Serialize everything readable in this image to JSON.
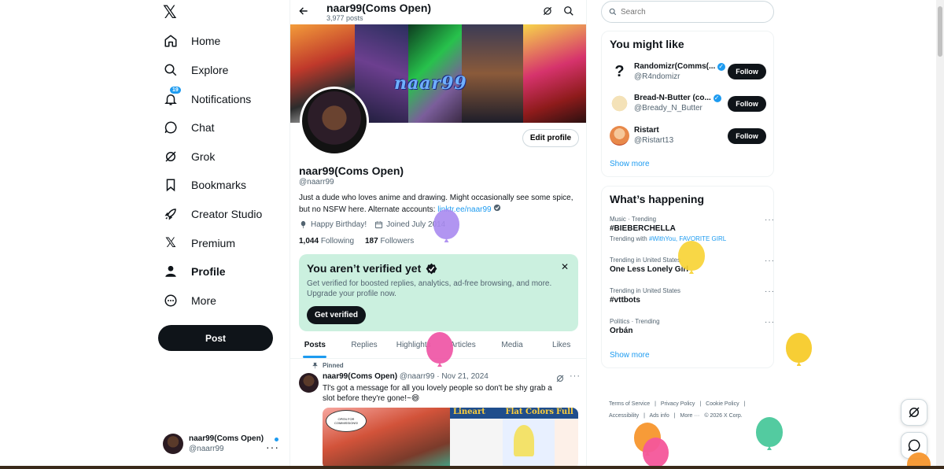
{
  "nav": {
    "logo": "𝕏",
    "items": [
      {
        "label": "Home",
        "icon": "home-icon"
      },
      {
        "label": "Explore",
        "icon": "search-icon"
      },
      {
        "label": "Notifications",
        "icon": "bell-icon",
        "badge": "19"
      },
      {
        "label": "Chat",
        "icon": "chat-icon"
      },
      {
        "label": "Grok",
        "icon": "grok-icon"
      },
      {
        "label": "Bookmarks",
        "icon": "bookmark-icon"
      },
      {
        "label": "Creator Studio",
        "icon": "rocket-icon"
      },
      {
        "label": "Premium",
        "icon": "x-logo-icon"
      },
      {
        "label": "Profile",
        "icon": "person-icon"
      },
      {
        "label": "More",
        "icon": "more-circle-icon"
      }
    ],
    "post_label": "Post",
    "account": {
      "display_name": "naar99(Coms Open)",
      "handle": "@naarr99"
    }
  },
  "header": {
    "title": "naar99(Coms Open)",
    "post_count": "3,977 posts"
  },
  "banner": {
    "text": "naar99"
  },
  "profile": {
    "edit_label": "Edit profile",
    "name": "naar99(Coms Open)",
    "handle": "@naarr99",
    "bio": "Just a dude who loves anime and drawing. Might occasionally see some spice, but no NSFW here. Alternate accounts: ",
    "bio_link": "linktr.ee/naar99",
    "birthday": "Happy Birthday!",
    "joined": "Joined July 2014",
    "following_count": "1,044",
    "following_label": "Following",
    "followers_count": "187",
    "followers_label": "Followers"
  },
  "verify": {
    "title": "You aren’t verified yet",
    "description": "Get verified for boosted replies, analytics, ad-free browsing, and more. Upgrade your profile now.",
    "button": "Get verified",
    "close": "✕"
  },
  "tabs": [
    "Posts",
    "Replies",
    "Highlights",
    "Articles",
    "Media",
    "Likes"
  ],
  "tweet": {
    "pinned": "Pinned",
    "name": "naar99(Coms Open)",
    "handle": "@naarr99",
    "date": "· Nov 21, 2024",
    "text": "Tl's got a message for all you lovely people so don't be shy grab a slot before they're gone!~😄",
    "media_labels": [
      "Lineart",
      "Flat Colors",
      "Full"
    ],
    "speech": "OPEN FOR COMMISSIONS!"
  },
  "search": {
    "placeholder": "Search"
  },
  "might_like": {
    "title": "You might like",
    "users": [
      {
        "name": "Randomizr(Comms(...",
        "handle": "@R4ndomizr",
        "follow": "Follow",
        "avatar_color": "#ffffff"
      },
      {
        "name": "Bread-N-Butter (co...",
        "handle": "@Bready_N_Butter",
        "follow": "Follow",
        "avatar_color": "#f4e2b8"
      },
      {
        "name": "Ristart",
        "handle": "@Ristart13",
        "follow": "Follow",
        "avatar_color": "#e8894a"
      }
    ],
    "show_more": "Show more"
  },
  "happening": {
    "title": "What’s happening",
    "trends": [
      {
        "context": "Music · Trending",
        "topic": "#BIEBERCHELLA",
        "extra_prefix": "Trending with ",
        "extra_links": "#WithYou, FAVORITE GIRL"
      },
      {
        "context": "Trending in United States",
        "topic": "One Less Lonely Girl"
      },
      {
        "context": "Trending in United States",
        "topic": "#vttbots"
      },
      {
        "context": "Politics · Trending",
        "topic": "Orbán"
      }
    ],
    "show_more": "Show more"
  },
  "footer": {
    "links": [
      "Terms of Service",
      "|",
      "Privacy Policy",
      "|",
      "Cookie Policy",
      "|",
      "Accessibility",
      "|",
      "Ads info",
      "|",
      "More ···",
      "© 2026 X Corp."
    ]
  },
  "colors": {
    "accent": "#1d9bf0",
    "verify_bg": "#cbf0df",
    "dark": "#0f1419"
  }
}
